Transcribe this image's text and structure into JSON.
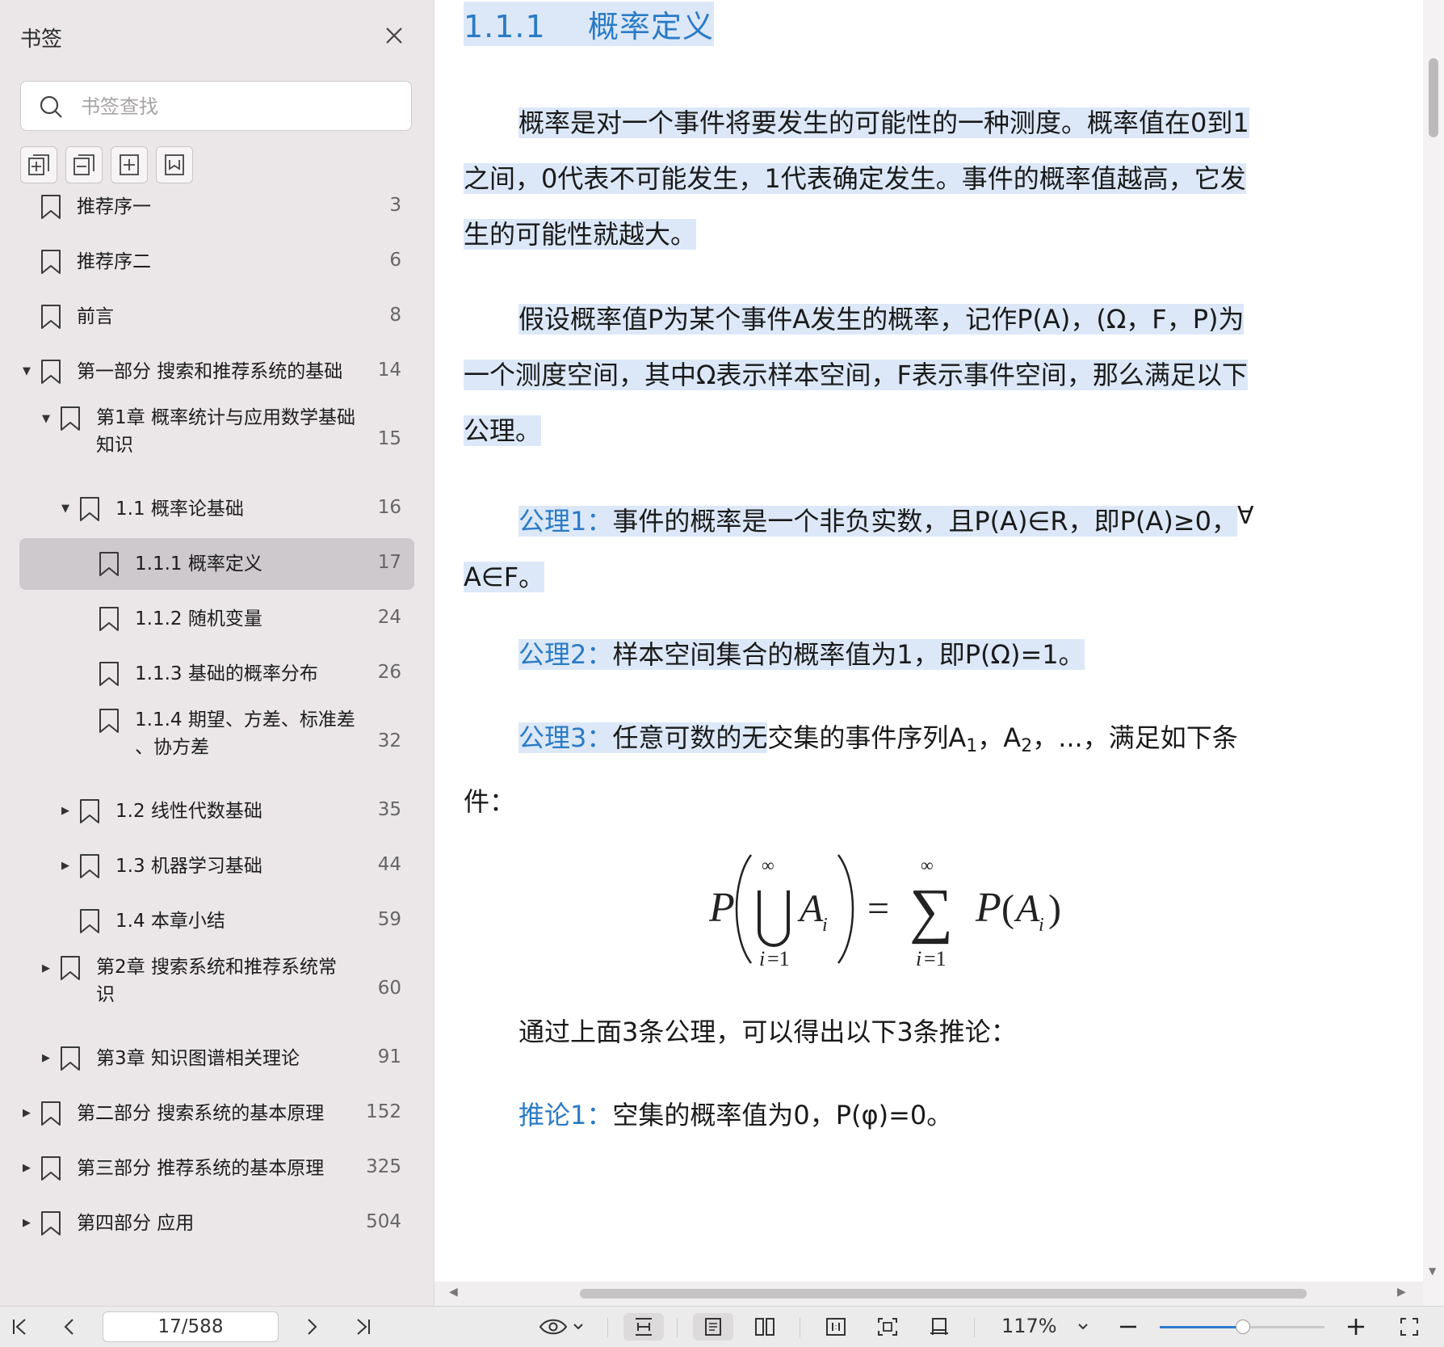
{
  "sidebar": {
    "title": "书签",
    "search_placeholder": "书签查找",
    "tools": [
      "expand-all-icon",
      "collapse-all-icon",
      "add-bookmark-icon",
      "bookmark-icon"
    ],
    "items": [
      {
        "label": "推荐序一",
        "page": "3",
        "arrow": ""
      },
      {
        "label": "推荐序二",
        "page": "6",
        "arrow": ""
      },
      {
        "label": "前言",
        "page": "8",
        "arrow": ""
      },
      {
        "label": "第一部分 搜索和推荐系统的基础",
        "page": "14",
        "arrow": "▼"
      },
      {
        "label": "第1章 概率统计与应用数学基础",
        "label2": "知识",
        "page": "15",
        "arrow": "▼"
      },
      {
        "label": "1.1 概率论基础",
        "page": "16",
        "arrow": "▼"
      },
      {
        "label": "1.1.1 概率定义",
        "page": "17",
        "arrow": "",
        "selected": true
      },
      {
        "label": "1.1.2 随机变量",
        "page": "24",
        "arrow": ""
      },
      {
        "label": "1.1.3 基础的概率分布",
        "page": "26",
        "arrow": ""
      },
      {
        "label": "1.1.4 期望、方差、标准差",
        "label2": "、协方差",
        "page": "32",
        "arrow": ""
      },
      {
        "label": "1.2 线性代数基础",
        "page": "35",
        "arrow": "▶"
      },
      {
        "label": "1.3 机器学习基础",
        "page": "44",
        "arrow": "▶"
      },
      {
        "label": "1.4 本章小结",
        "page": "59",
        "arrow": ""
      },
      {
        "label": "第2章 搜索系统和推荐系统常",
        "label2": "识",
        "page": "60",
        "arrow": "▶"
      },
      {
        "label": "第3章 知识图谱相关理论",
        "page": "91",
        "arrow": "▶"
      },
      {
        "label": "第二部分 搜索系统的基本原理",
        "page": "152",
        "arrow": "▶"
      },
      {
        "label": "第三部分 推荐系统的基本原理",
        "page": "325",
        "arrow": "▶"
      },
      {
        "label": "第四部分 应用",
        "page": "504",
        "arrow": "▶"
      }
    ]
  },
  "document": {
    "heading_num": "1.1.1",
    "heading_text": "概率定义",
    "p1_l1": "概率是对一个事件将要发生的可能性的一种测度。概率值在0到1",
    "p1_l2": "之间，0代表不可能发生，1代表确定发生。事件的概率值越高，它发",
    "p1_l3": "生的可能性就越大。",
    "p2_l1": "假设概率值P为某个事件A发生的概率，记作P(A)，(Ω，F，P)为",
    "p2_l2": "一个测度空间，其中Ω表示样本空间，F表示事件空间，那么满足以下",
    "p2_l3": "公理。",
    "ax1_label": "公理1：",
    "ax1_text": "事件的概率是一个非负实数，且P(A)∈R，即P(A)≥0，",
    "ax1_forall": "∀",
    "ax1_l2": "A∈F。",
    "ax2_label": "公理2：",
    "ax2_text": "样本空间集合的概率值为1，即P(Ω)=1。",
    "ax3_label": "公理3：",
    "ax3_hl": "任意可数的无",
    "ax3_rest": "交集的事件序列A",
    "ax3_s1": "1",
    "ax3_mid": "，A",
    "ax3_s2": "2",
    "ax3_end": "，...，满足如下条",
    "ax3_l2": "件：",
    "summary": "通过上面3条公理，可以得出以下3条推论：",
    "cor1_label": "推论1：",
    "cor1_text": "空集的概率值为0，P(φ)=0。"
  },
  "toolbar": {
    "page_indicator": "17/588",
    "zoom": "117%",
    "zoom_level": 0.5
  },
  "colors": {
    "accent": "#2a7bc6",
    "highlight": "#dce8f8",
    "sidebar_bg": "#ebe7e9"
  }
}
